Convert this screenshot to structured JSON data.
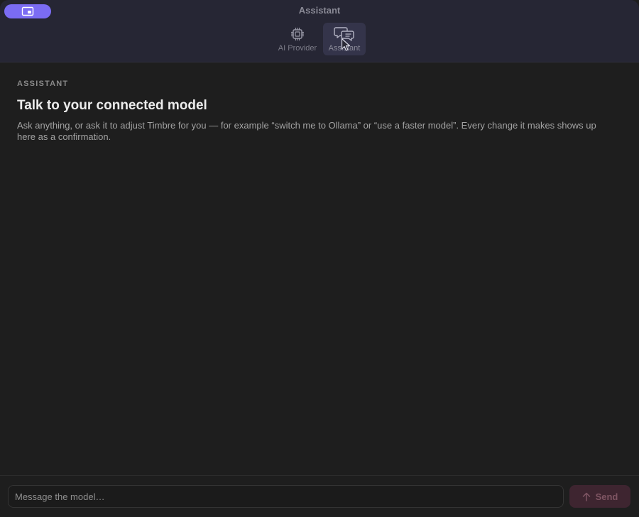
{
  "window": {
    "title": "Assistant"
  },
  "toolbar": {
    "items": [
      {
        "label": "AI Provider",
        "icon": "chip-icon",
        "selected": false
      },
      {
        "label": "Assistant",
        "icon": "chat-bubbles-icon",
        "selected": true
      }
    ],
    "pill_icon": "sidebar-toggle-icon"
  },
  "main": {
    "eyebrow": "ASSISTANT",
    "heading": "Talk to your connected model",
    "description": "Ask anything, or ask it to adjust Timbre for you — for example “switch me to Ollama” or “use a faster model”. Every change it makes shows up here as a confirmation."
  },
  "composer": {
    "placeholder": "Message the model…",
    "value": "",
    "send_label": "Send",
    "send_icon": "arrow-up-icon"
  },
  "colors": {
    "accent": "#7b6cf3",
    "send_button_bg": "#3e2530",
    "send_button_text": "#7f5563",
    "titlebar_bg": "#262634",
    "content_bg": "#1e1e1e"
  }
}
